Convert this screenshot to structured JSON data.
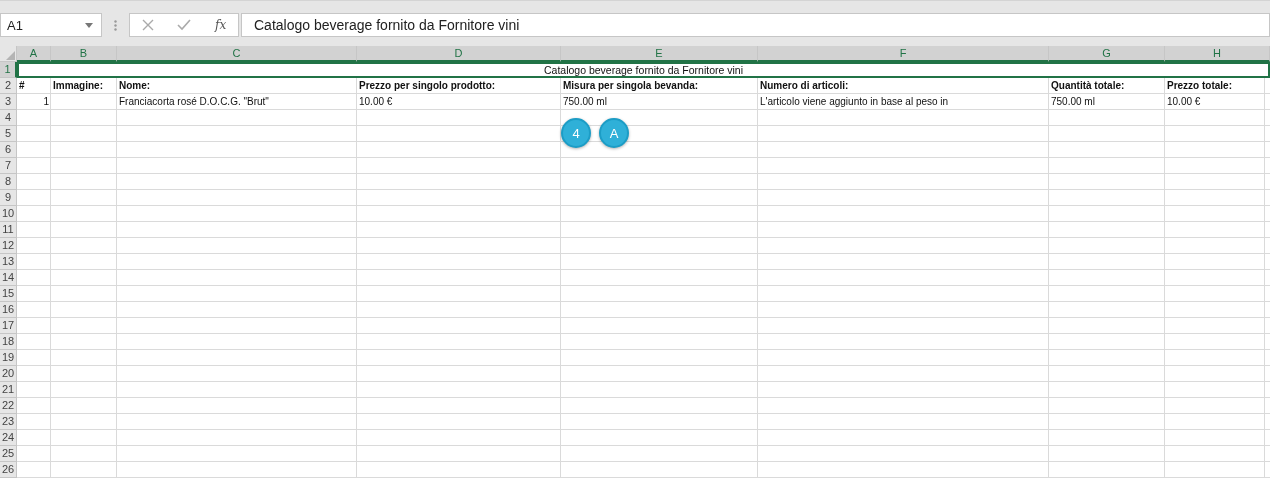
{
  "formula_bar": {
    "name_box": "A1",
    "function_label": "fx",
    "formula": "Catalogo beverage fornito da Fornitore vini"
  },
  "columns": [
    {
      "label": "A",
      "selected": true
    },
    {
      "label": "B",
      "selected": true
    },
    {
      "label": "C",
      "selected": true
    },
    {
      "label": "D",
      "selected": true
    },
    {
      "label": "E",
      "selected": true
    },
    {
      "label": "F",
      "selected": true
    },
    {
      "label": "G",
      "selected": true
    },
    {
      "label": "H",
      "selected": true
    }
  ],
  "rows": [
    {
      "number": "1",
      "selected": true,
      "kind": "title",
      "title": "Catalogo beverage fornito da Fornitore vini"
    },
    {
      "number": "2",
      "selected": false,
      "kind": "header",
      "cells": [
        {
          "text": "#",
          "kind": "text"
        },
        {
          "text": "Immagine:",
          "kind": "text"
        },
        {
          "text": "Nome:",
          "kind": "text"
        },
        {
          "text": "Prezzo per singolo prodotto:",
          "kind": "text"
        },
        {
          "text": "Misura per singola bevanda:",
          "kind": "text"
        },
        {
          "text": "Numero di articoli:",
          "kind": "text"
        },
        {
          "text": "Quantità totale:",
          "kind": "text"
        },
        {
          "text": "Prezzo totale:",
          "kind": "text"
        }
      ]
    },
    {
      "number": "3",
      "selected": false,
      "kind": "data",
      "cells": [
        {
          "text": "1",
          "kind": "number"
        },
        null,
        {
          "text": "Franciacorta rosé D.O.C.G. \"Brut\"",
          "kind": "text"
        },
        {
          "text": "10.00 €",
          "kind": "text"
        },
        {
          "text": "750.00 ml",
          "kind": "text"
        },
        {
          "text": "L'articolo viene aggiunto in base al peso in",
          "kind": "text"
        },
        {
          "text": "750.00 ml",
          "kind": "text"
        },
        {
          "text": "10.00 €",
          "kind": "text"
        }
      ]
    },
    {
      "number": "4",
      "selected": false,
      "kind": "empty"
    },
    {
      "number": "5",
      "selected": false,
      "kind": "empty"
    },
    {
      "number": "6",
      "selected": false,
      "kind": "empty"
    },
    {
      "number": "7",
      "selected": false,
      "kind": "empty"
    },
    {
      "number": "8",
      "selected": false,
      "kind": "empty"
    },
    {
      "number": "9",
      "selected": false,
      "kind": "empty"
    },
    {
      "number": "10",
      "selected": false,
      "kind": "empty"
    },
    {
      "number": "11",
      "selected": false,
      "kind": "empty"
    },
    {
      "number": "12",
      "selected": false,
      "kind": "empty"
    },
    {
      "number": "13",
      "selected": false,
      "kind": "empty"
    },
    {
      "number": "14",
      "selected": false,
      "kind": "empty"
    },
    {
      "number": "15",
      "selected": false,
      "kind": "empty"
    },
    {
      "number": "16",
      "selected": false,
      "kind": "empty"
    },
    {
      "number": "17",
      "selected": false,
      "kind": "empty"
    },
    {
      "number": "18",
      "selected": false,
      "kind": "empty"
    },
    {
      "number": "19",
      "selected": false,
      "kind": "empty"
    },
    {
      "number": "20",
      "selected": false,
      "kind": "empty"
    },
    {
      "number": "21",
      "selected": false,
      "kind": "empty"
    },
    {
      "number": "22",
      "selected": false,
      "kind": "empty"
    },
    {
      "number": "23",
      "selected": false,
      "kind": "empty"
    },
    {
      "number": "24",
      "selected": false,
      "kind": "empty"
    },
    {
      "number": "25",
      "selected": false,
      "kind": "empty"
    },
    {
      "number": "26",
      "selected": false,
      "kind": "empty"
    }
  ],
  "badges": [
    {
      "label": "4"
    },
    {
      "label": "A"
    }
  ]
}
